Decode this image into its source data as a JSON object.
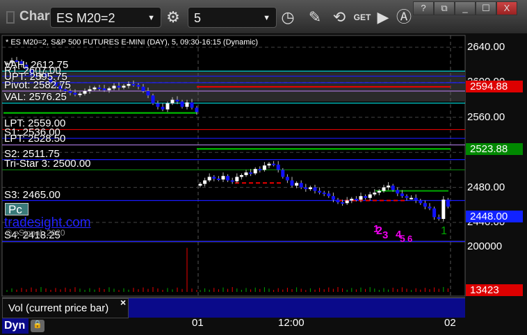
{
  "window": {
    "title": "Chart",
    "symbol": "ES M20=2",
    "interval": "5",
    "help": "?",
    "close": "X"
  },
  "toolbar_icons": [
    "settings-icon",
    "clock-icon",
    "pencil-icon",
    "study-icon",
    "get-icon",
    "play-icon",
    "alert-icon"
  ],
  "chart": {
    "header": "* ES M20=2, S&P 500 FUTURES E-MINI (DAY), 5, 09:30-16:15 (Dynamic)",
    "price_axis": [
      "2640.00",
      "2600.00",
      "2560.00",
      "2520.00",
      "2480.00",
      "2440.00"
    ],
    "price_tags": {
      "last_red": "2594.88",
      "green": "2523.88",
      "current": "2448.00"
    },
    "levels": [
      {
        "label": "VAH: 2612.75",
        "price": 2612.75,
        "color": "#00e5e5"
      },
      {
        "label": "R1: 2607.00",
        "price": 2607.0,
        "color": "#1a1aff"
      },
      {
        "label": "UPT: 2595.75",
        "price": 2599.5,
        "color": "#1a1aff"
      },
      {
        "label": "Pivot: 2582.75",
        "price": 2590,
        "color": "#a070d0"
      },
      {
        "label": "VAL: 2576.25",
        "price": 2576.25,
        "color": "#00e5e5"
      },
      {
        "label": "LPT: 2559.00",
        "price": 2546,
        "color": "#e00000"
      },
      {
        "label": "S1: 2536.00",
        "price": 2536.0,
        "color": "#1a1aff"
      },
      {
        "label": "LPT: 2528.50",
        "price": 2528.5,
        "color": "#a070d0"
      },
      {
        "label": "S2: 2511.75",
        "price": 2511.75,
        "color": "#1a1aff"
      },
      {
        "label": "Tri-Star 3: 2500.00",
        "price": 2500.0,
        "color": "#0a7a0a"
      },
      {
        "label": "S3: 2465.00",
        "price": 2465.0,
        "color": "#1a1aff"
      },
      {
        "label": "S4: 2418.25",
        "price": 2418.25,
        "color": "#1a1aff"
      }
    ],
    "badge": "Pc",
    "watermark": "tradesight.com",
    "copyright": "© eSignal, 2020",
    "annotations": [
      "1",
      "2",
      "3",
      "4",
      "5",
      "6",
      "1"
    ],
    "time_axis": [
      "01",
      "12:00",
      "02"
    ]
  },
  "volume": {
    "axis": [
      "200000"
    ],
    "current": "13423",
    "panel_label": "Vol (current price bar)",
    "close_label": "×"
  },
  "bottom": {
    "dyn": "Dyn"
  },
  "chart_data": {
    "type": "candlestick",
    "session1_closes": [
      2622,
      2625,
      2624,
      2620,
      2615,
      2608,
      2606,
      2610,
      2606,
      2600,
      2596,
      2592,
      2590,
      2588,
      2586,
      2587,
      2590,
      2592,
      2594,
      2593,
      2591,
      2593,
      2596,
      2594,
      2596,
      2598,
      2597,
      2595,
      2590,
      2585,
      2576,
      2572,
      2569,
      2576,
      2580,
      2578,
      2572,
      2577,
      2571,
      2566
    ],
    "session2_closes": [
      2484,
      2488,
      2492,
      2490,
      2489,
      2493,
      2488,
      2487,
      2492,
      2494,
      2497,
      2496,
      2501,
      2500,
      2505,
      2507,
      2506,
      2500,
      2492,
      2488,
      2482,
      2485,
      2480,
      2478,
      2480,
      2476,
      2474,
      2473,
      2470,
      2466,
      2463,
      2462,
      2465,
      2467,
      2466,
      2470,
      2468,
      2472,
      2474,
      2476,
      2480,
      2482,
      2477,
      2473,
      2470,
      2468,
      2468,
      2465,
      2462,
      2458,
      2456,
      2446,
      2444,
      2466,
      2458
    ],
    "volume_spike": 195000,
    "ylim": [
      2420,
      2650
    ]
  }
}
